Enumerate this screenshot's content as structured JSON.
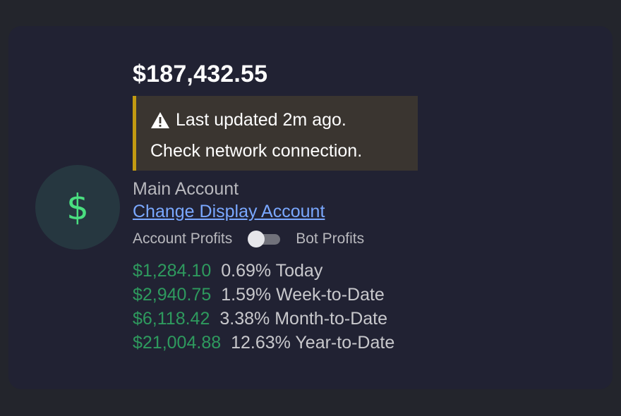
{
  "balance": "$187,432.55",
  "warning": {
    "line1": "Last updated 2m ago.",
    "line2": "Check network connection.",
    "icon": "warning-triangle-icon"
  },
  "avatar_icon": "$",
  "account": {
    "name": "Main Account",
    "change_label": "Change Display Account"
  },
  "toggle": {
    "left_label": "Account Profits",
    "right_label": "Bot Profits",
    "state": "off"
  },
  "profits": [
    {
      "amount": "$1,284.10",
      "percent": "0.69%",
      "period": "Today"
    },
    {
      "amount": "$2,940.75",
      "percent": "1.59%",
      "period": "Week-to-Date"
    },
    {
      "amount": "$6,118.42",
      "percent": "3.38%",
      "period": "Month-to-Date"
    },
    {
      "amount": "$21,004.88",
      "percent": "12.63%",
      "period": "Year-to-Date"
    }
  ],
  "colors": {
    "accent_green": "#4ade80",
    "profit_green": "#2e9a5e",
    "link_blue": "#7aa8ff",
    "warning_border": "#c29a12"
  }
}
